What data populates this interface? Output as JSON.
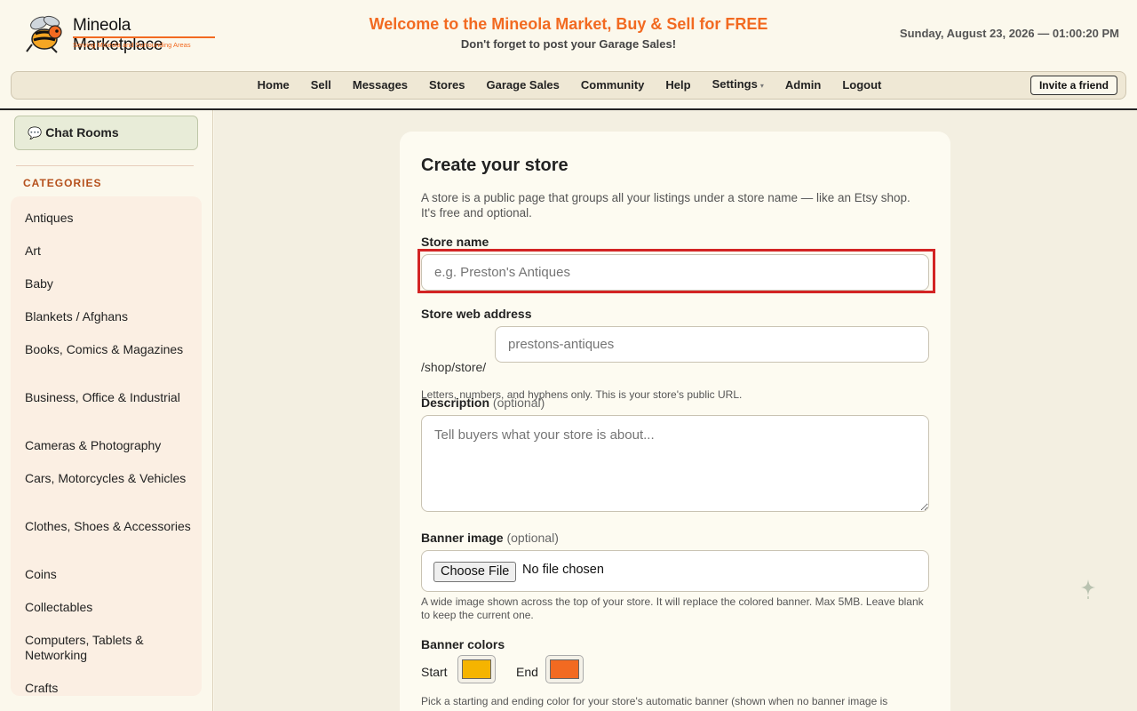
{
  "header": {
    "logo_title": "Mineola Marketplace",
    "logo_subtitle": "Serving Mineola and Surrounding Areas",
    "welcome": "Welcome to the Mineola Market, Buy & Sell for FREE",
    "welcome_sub": "Don't forget to post your Garage Sales!",
    "datetime": "Sunday, August 23, 2026 — 01:00:20 PM"
  },
  "nav": {
    "items": [
      "Home",
      "Sell",
      "Messages",
      "Stores",
      "Garage Sales",
      "Community",
      "Help",
      "Settings",
      "Admin",
      "Logout"
    ],
    "settings_caret": "▾",
    "invite_label": "Invite a friend"
  },
  "sidebar": {
    "chat_rooms_label": "Chat Rooms",
    "chat_icon": "speech-bubble-icon",
    "categories_heading": "CATEGORIES",
    "categories": [
      "Antiques",
      "Art",
      "Baby",
      "Blankets / Afghans",
      "Books, Comics & Magazines",
      "Business, Office & Industrial",
      "Cameras & Photography",
      "Cars, Motorcycles & Vehicles",
      "Clothes, Shoes & Accessories",
      "Coins",
      "Collectables",
      "Computers, Tablets & Networking",
      "Crafts"
    ]
  },
  "form": {
    "title": "Create your store",
    "description": "A store is a public page that groups all your listings under a store name — like an Etsy shop. It's free and optional.",
    "store_name_label": "Store name",
    "store_name_placeholder": "e.g. Preston's Antiques",
    "store_address_label": "Store web address",
    "store_address_prefix": "/shop/store/",
    "store_address_placeholder": "prestons-antiques",
    "store_address_help": "Letters, numbers, and hyphens only. This is your store's public URL.",
    "description_label": "Description",
    "optional_suffix": "(optional)",
    "description_placeholder": "Tell buyers what your store is about...",
    "banner_image_label": "Banner image",
    "choose_file_label": "Choose File",
    "no_file_label": "No file chosen",
    "banner_image_help": "A wide image shown across the top of your store. It will replace the colored banner. Max 5MB. Leave blank to keep the current one.",
    "banner_colors_label": "Banner colors",
    "start_label": "Start",
    "end_label": "End",
    "start_color": "#f5b400",
    "end_color": "#f26a21",
    "banner_colors_help": "Pick a starting and ending color for your store's automatic banner (shown when no banner image is"
  },
  "colors": {
    "accent": "#f26a21",
    "highlight": "#d32424"
  }
}
